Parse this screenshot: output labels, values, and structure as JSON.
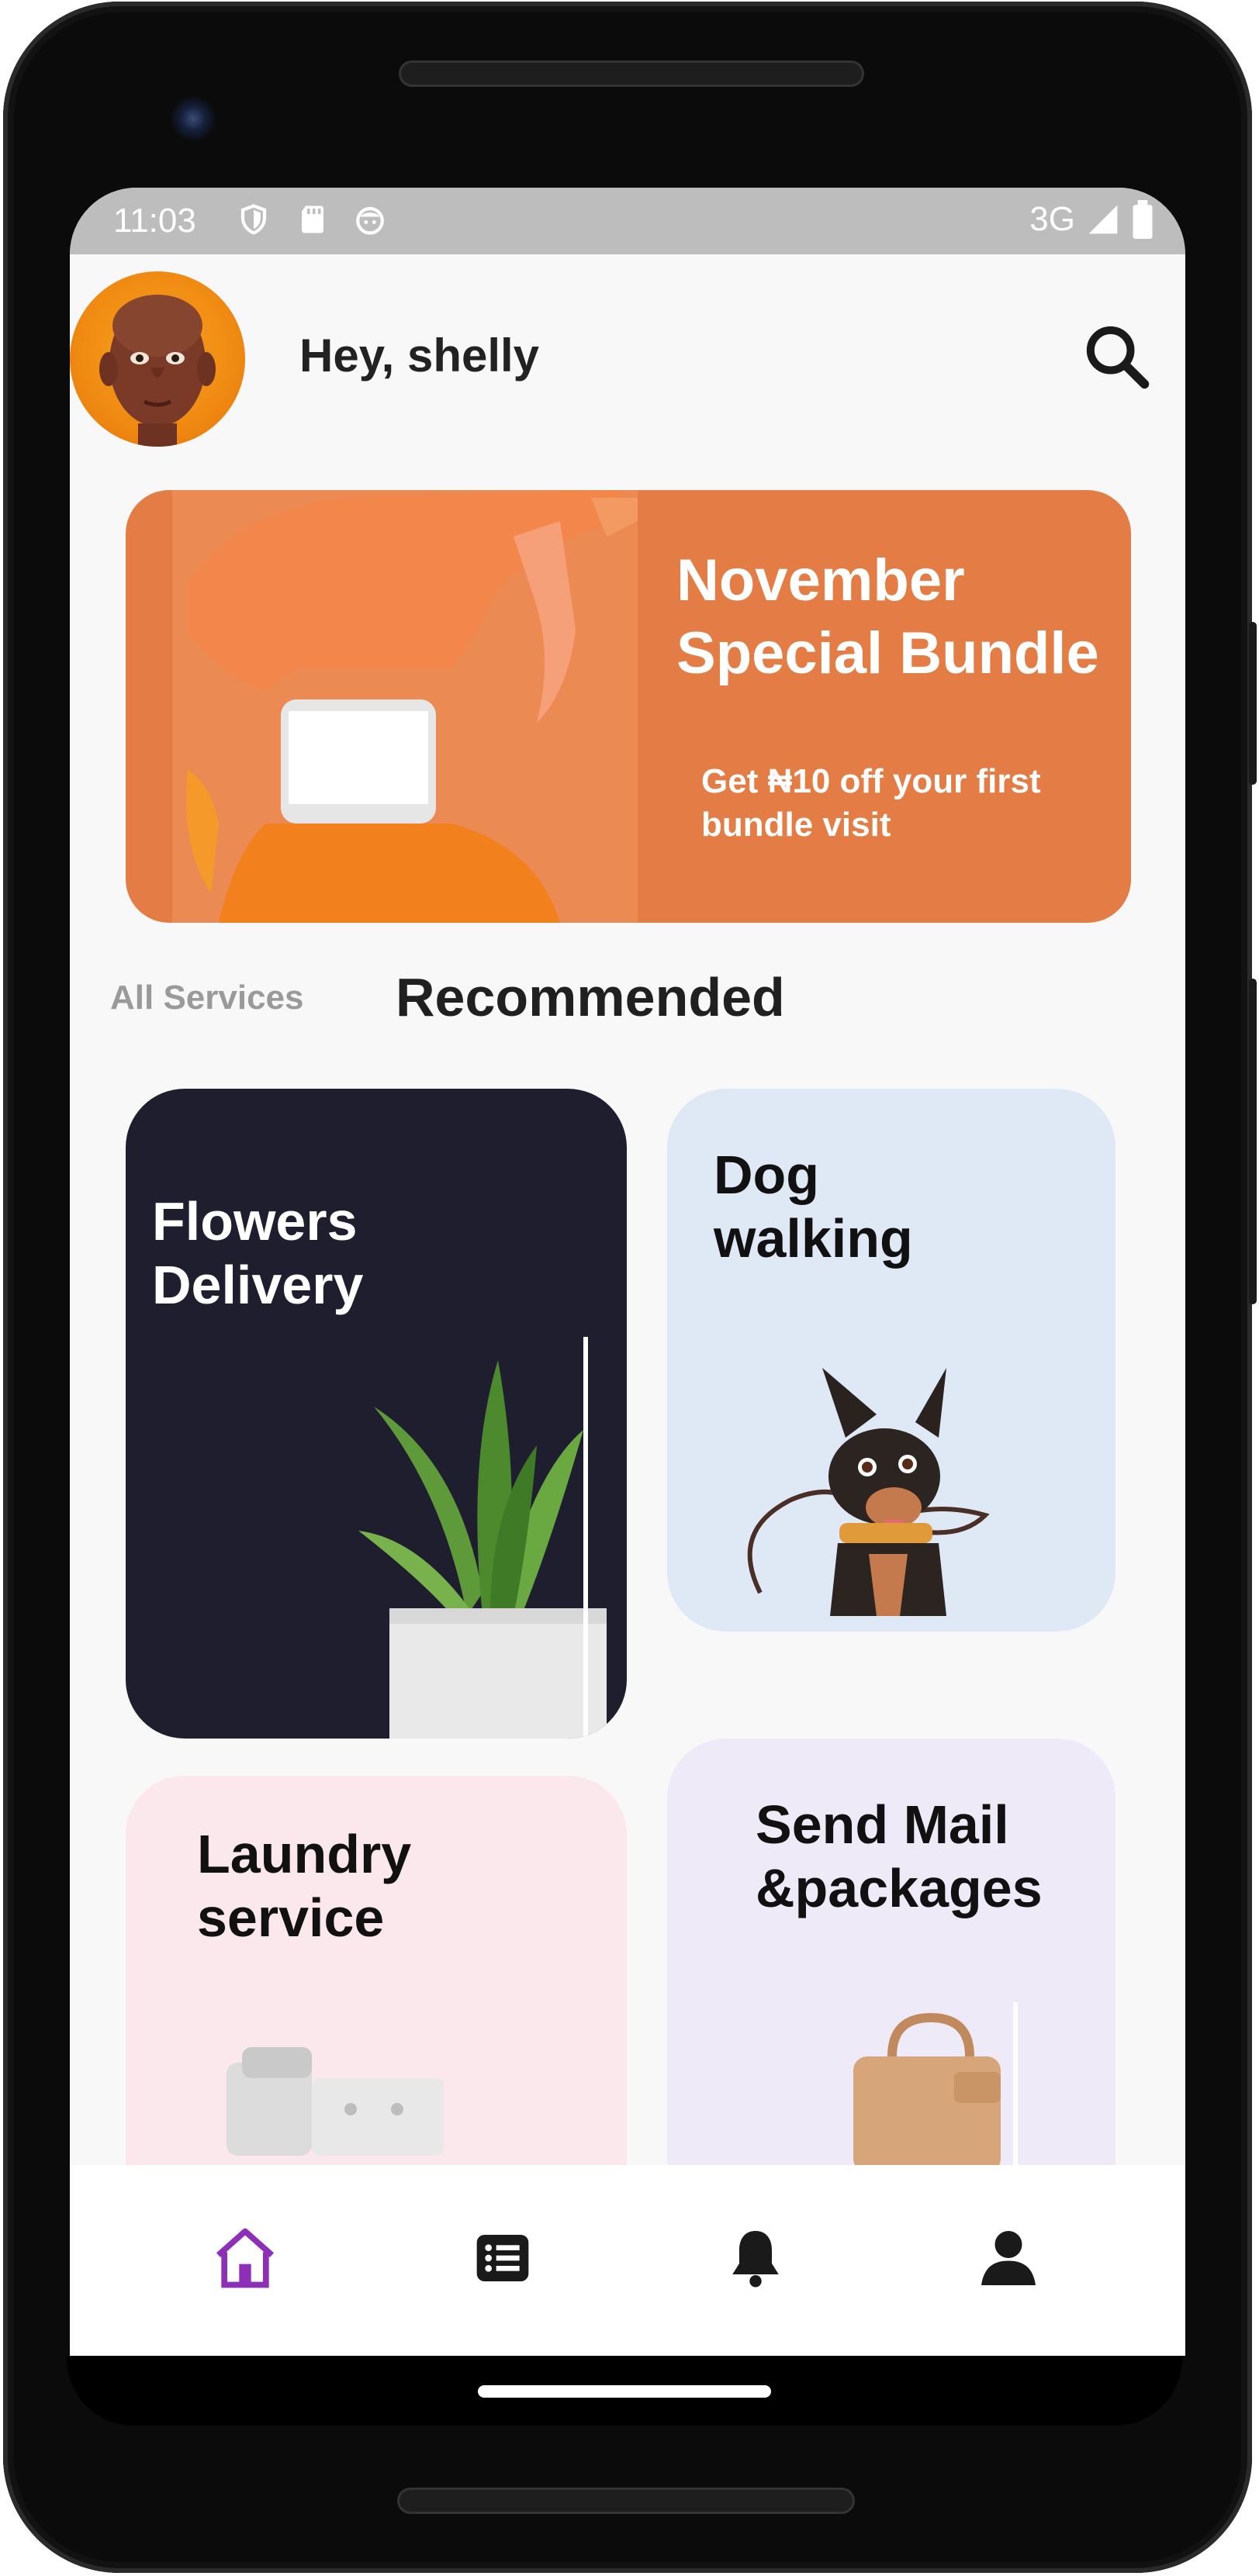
{
  "status_bar": {
    "time": "11:03",
    "network": "3G",
    "icons": [
      "shield-icon",
      "sd-card-icon",
      "android-face-icon",
      "signal-icon",
      "battery-icon"
    ]
  },
  "header": {
    "greeting": "Hey, shelly",
    "avatar": "user-avatar",
    "search_icon": "search-icon"
  },
  "banner": {
    "title": "November Special Bundle",
    "subtitle": "Get ₦10 off your first bundle visit",
    "color": "#e37d45"
  },
  "tabs": {
    "all_services": "All Services",
    "recommended": "Recommended"
  },
  "services": [
    {
      "title": "Flowers Delivery",
      "color": "#1f1e2e",
      "text_color": "#ffffff"
    },
    {
      "title": "Dog walking",
      "color": "#dfe9f6",
      "text_color": "#111111"
    },
    {
      "title": "Laundry service",
      "color": "#fae8ec",
      "text_color": "#111111"
    },
    {
      "title": "Send Mail &packages",
      "color": "#eeeaf8",
      "text_color": "#111111"
    }
  ],
  "bottom_nav": {
    "items": [
      "home-icon",
      "list-icon",
      "bell-icon",
      "profile-icon"
    ],
    "active": "home-icon",
    "active_color": "#8e2fb8"
  }
}
